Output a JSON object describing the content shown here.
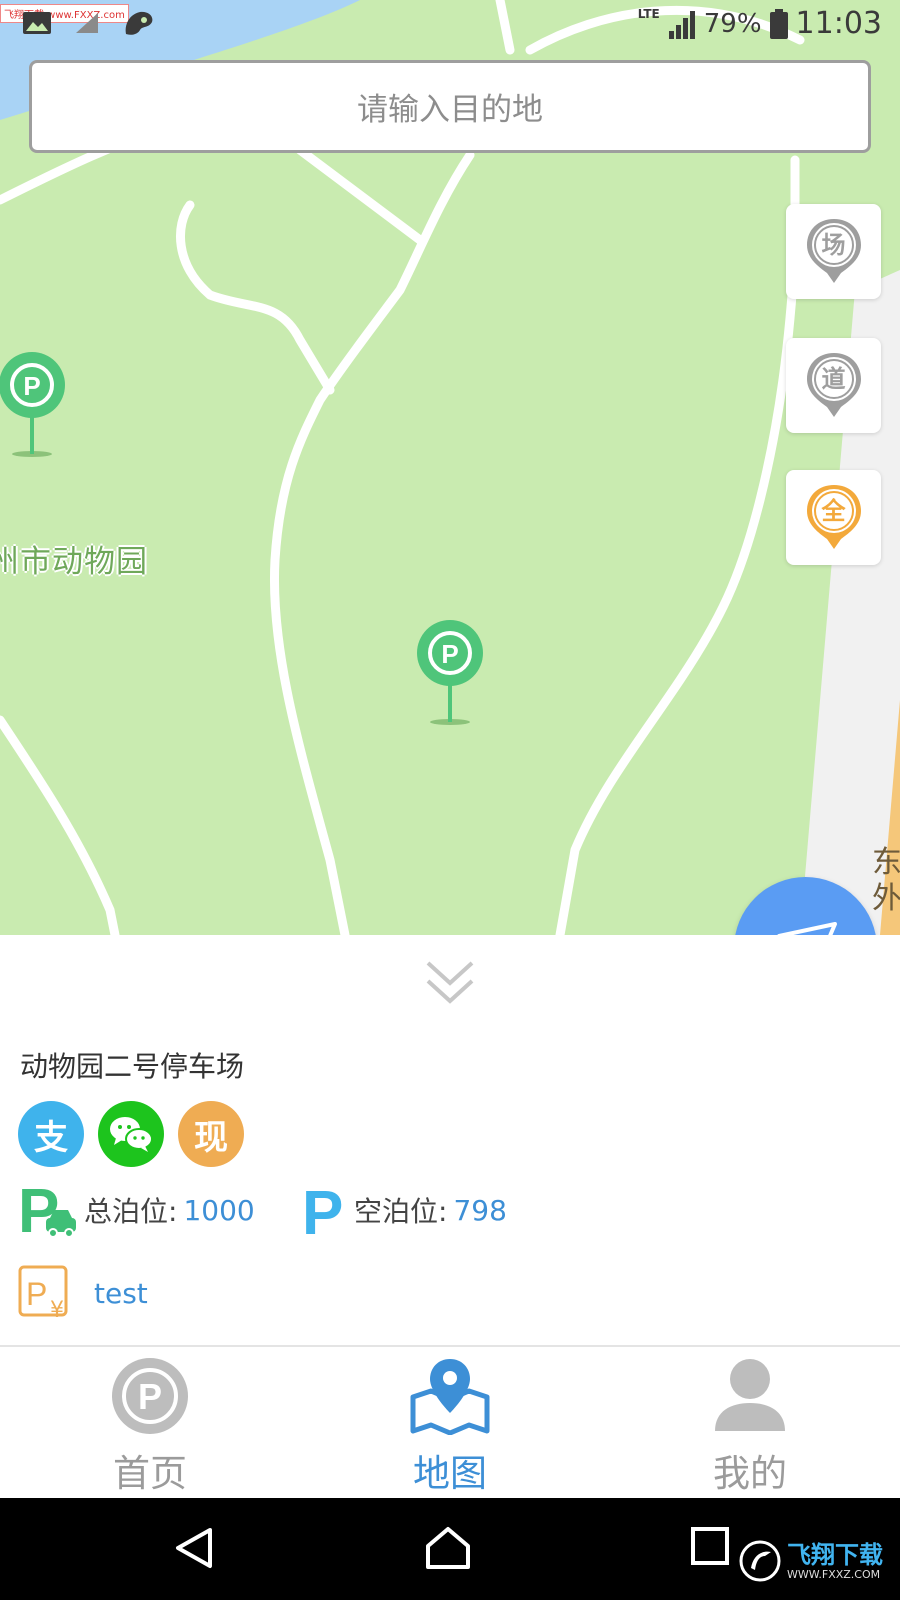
{
  "status_bar": {
    "watermark": "飞翔下载 www.FXXZ.com",
    "network": "LTE",
    "battery": "79%",
    "time": "11:03"
  },
  "search": {
    "placeholder": "请输入目的地"
  },
  "map": {
    "place_label": "州市动物园",
    "road_label": "东外",
    "pins": [
      "parking-pin",
      "parking-pin"
    ]
  },
  "filters": [
    {
      "label": "场",
      "color": "#9e9e9e"
    },
    {
      "label": "道",
      "color": "#9e9e9e"
    },
    {
      "label": "全",
      "color": "#f3a93b"
    }
  ],
  "panel": {
    "lot_name": "动物园二号停车场",
    "payments": [
      {
        "icon": "alipay-icon",
        "glyph": "支",
        "color": "#3fb3ec"
      },
      {
        "icon": "wechat-pay-icon",
        "glyph": "",
        "color": "#1dc41d"
      },
      {
        "icon": "cash-icon",
        "glyph": "现",
        "color": "#efac53"
      }
    ],
    "total_label": "总泊位:",
    "total_value": "1000",
    "free_label": "空泊位:",
    "free_value": "798",
    "price_text": "test"
  },
  "bottom_nav": [
    {
      "label": "首页",
      "active": false
    },
    {
      "label": "地图",
      "active": true
    },
    {
      "label": "我的",
      "active": false
    }
  ],
  "watermark_bottom": {
    "title": "飞翔下载",
    "url": "WWW.FXXZ.COM"
  },
  "colors": {
    "accent": "#3d8fd6",
    "map_green": "#c9ebb0",
    "locate_blue": "#5a9cf3"
  }
}
